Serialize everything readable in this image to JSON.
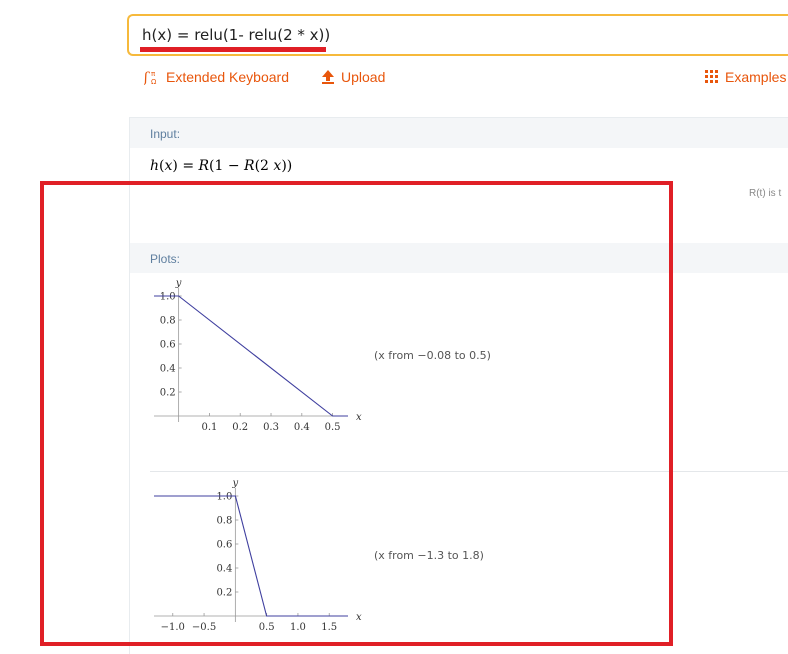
{
  "search": {
    "query": "h(x) = relu(1- relu(2 * x))"
  },
  "toolbar": {
    "extended_keyboard": "Extended Keyboard",
    "upload": "Upload",
    "examples": "Examples"
  },
  "input_pod": {
    "title": "Input:",
    "formula": {
      "lhs_fn": "h",
      "lhs_var": "x",
      "rhs_a": "R",
      "rhs_b": "(1 − ",
      "rhs_c": "R",
      "rhs_d": "(2 ",
      "rhs_e": "x",
      "rhs_f": "))"
    },
    "note": "R(t) is t"
  },
  "plots_pod": {
    "title": "Plots:"
  },
  "chart_data": [
    {
      "type": "line",
      "xlabel": "x",
      "ylabel": "y",
      "xlim": [
        -0.08,
        0.55
      ],
      "ylim": [
        0,
        1.05
      ],
      "x_ticks": [
        0.1,
        0.2,
        0.3,
        0.4,
        0.5
      ],
      "y_ticks": [
        0.2,
        0.4,
        0.6,
        0.8,
        1.0
      ],
      "series": [
        {
          "x": [
            -0.08,
            0,
            0.5,
            0.55
          ],
          "y": [
            1,
            1,
            0,
            0
          ]
        }
      ],
      "range_note": "x from −0.08 to 0.5"
    },
    {
      "type": "line",
      "xlabel": "x",
      "ylabel": "y",
      "xlim": [
        -1.3,
        1.8
      ],
      "ylim": [
        0,
        1.05
      ],
      "x_ticks": [
        -1.0,
        -0.5,
        0.5,
        1.0,
        1.5
      ],
      "y_ticks": [
        0.2,
        0.4,
        0.6,
        0.8,
        1.0
      ],
      "series": [
        {
          "x": [
            -1.3,
            0,
            0.5,
            1.8
          ],
          "y": [
            1,
            1,
            0,
            0
          ]
        }
      ],
      "range_note": "x from −1.3 to 1.8"
    }
  ],
  "colors": {
    "accent": "#e8560c",
    "focus_border": "#f6b93b",
    "highlight": "#e01f26",
    "plot_line": "#3f3f9f"
  }
}
